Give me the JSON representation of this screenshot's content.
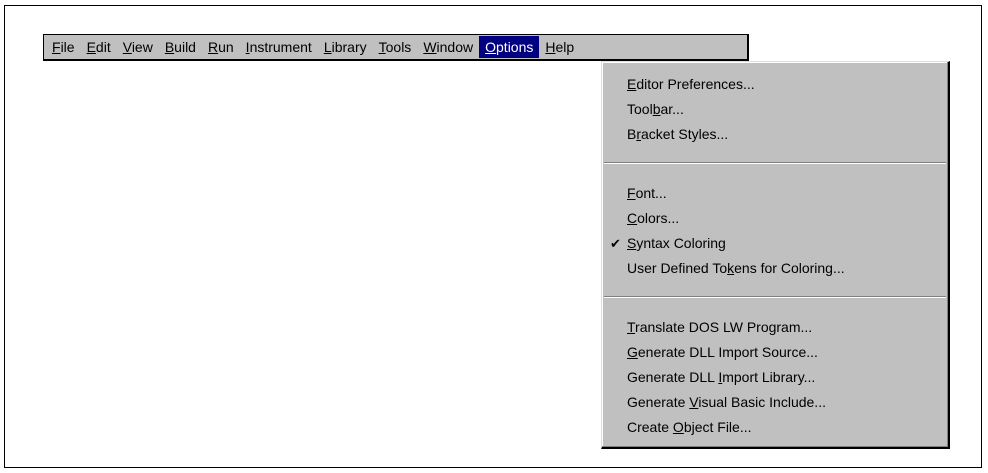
{
  "menubar": {
    "items": [
      {
        "pre": "",
        "key": "F",
        "post": "ile"
      },
      {
        "pre": "",
        "key": "E",
        "post": "dit"
      },
      {
        "pre": "",
        "key": "V",
        "post": "iew"
      },
      {
        "pre": "",
        "key": "B",
        "post": "uild"
      },
      {
        "pre": "",
        "key": "R",
        "post": "un"
      },
      {
        "pre": "",
        "key": "I",
        "post": "nstrument"
      },
      {
        "pre": "",
        "key": "L",
        "post": "ibrary"
      },
      {
        "pre": "",
        "key": "T",
        "post": "ools"
      },
      {
        "pre": "",
        "key": "W",
        "post": "indow"
      },
      {
        "pre": "",
        "key": "O",
        "post": "ptions"
      },
      {
        "pre": "",
        "key": "H",
        "post": "elp"
      }
    ],
    "active_item": "Options"
  },
  "options_menu": {
    "group1": [
      {
        "pre": "",
        "key": "E",
        "post": "ditor Preferences..."
      },
      {
        "pre": "Tool",
        "key": "b",
        "post": "ar..."
      },
      {
        "pre": "B",
        "key": "r",
        "post": "acket Styles..."
      }
    ],
    "group2": [
      {
        "pre": "",
        "key": "F",
        "post": "ont..."
      },
      {
        "pre": "",
        "key": "C",
        "post": "olors..."
      },
      {
        "pre": "",
        "key": "S",
        "post": "yntax Coloring",
        "checked": true,
        "check_glyph": "✔"
      },
      {
        "pre": "User Defined To",
        "key": "k",
        "post": "ens for Coloring..."
      }
    ],
    "group3": [
      {
        "pre": "",
        "key": "T",
        "post": "ranslate DOS LW Program..."
      },
      {
        "pre": "",
        "key": "G",
        "post": "enerate DLL Import Source..."
      },
      {
        "pre": "Generate DLL ",
        "key": "I",
        "post": "mport Library..."
      },
      {
        "pre": "Generate ",
        "key": "V",
        "post": "isual Basic Include..."
      },
      {
        "pre": "Create ",
        "key": "O",
        "post": "bject File..."
      }
    ]
  },
  "colors": {
    "menu_bg": "#c0c0c0",
    "highlight_bg": "#000080",
    "highlight_fg": "#ffffff"
  }
}
